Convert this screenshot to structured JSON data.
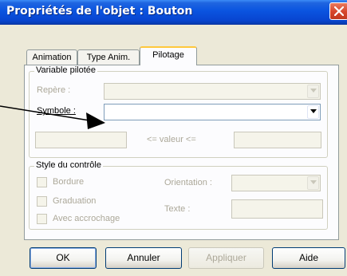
{
  "window": {
    "title": "Propriétés de l'objet : Bouton"
  },
  "tabs": [
    {
      "label": "Animation",
      "active": false
    },
    {
      "label": "Type Anim.",
      "active": false
    },
    {
      "label": "Pilotage",
      "active": true
    }
  ],
  "variable_group": {
    "legend": "Variable pilotée",
    "repere_label": "Repère :",
    "repere_value": "",
    "symbole_label": "Symbole :",
    "symbole_value": "",
    "range_min": "",
    "range_text": "<= valeur <=",
    "range_max": ""
  },
  "style_group": {
    "legend": "Style du contrôle",
    "bordure_label": "Bordure",
    "graduation_label": "Graduation",
    "accrochage_label": "Avec accrochage",
    "orientation_label": "Orientation :",
    "orientation_value": "",
    "texte_label": "Texte :",
    "texte_value": ""
  },
  "buttons": {
    "ok": "OK",
    "annuler": "Annuler",
    "appliquer": "Appliquer",
    "aide": "Aide"
  },
  "colors": {
    "titlebar": "#0a54e0",
    "tab_highlight": "#ffc83c",
    "panel_bg": "#fcfcfe",
    "dialog_bg": "#ece9d8",
    "disabled_text": "#aca899"
  },
  "icons": {
    "close": "close-icon",
    "dropdown": "chevron-down-icon",
    "pointer_arrow": "arrow-icon"
  }
}
